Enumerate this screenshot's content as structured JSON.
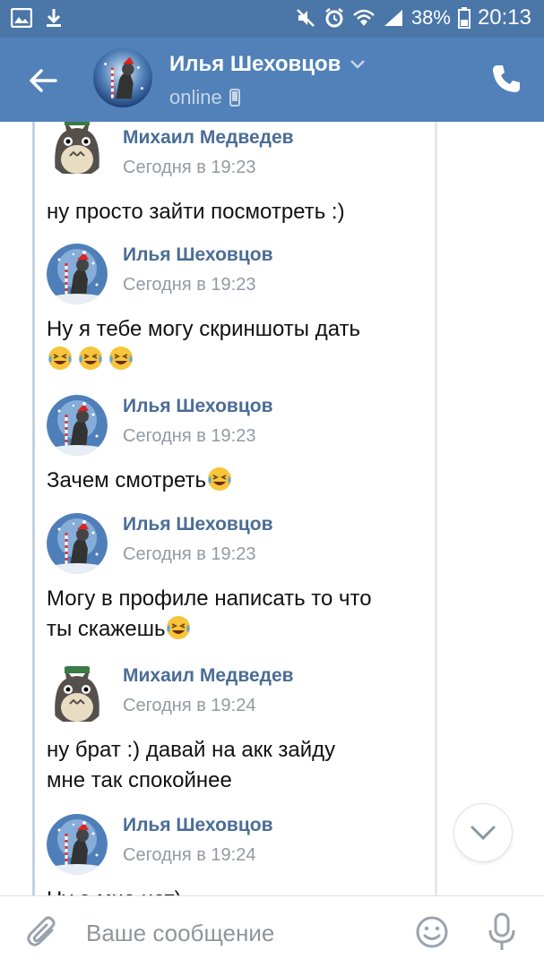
{
  "status_bar": {
    "battery": "38%",
    "time": "20:13"
  },
  "header": {
    "contact_name": "Илья Шеховцов",
    "status": "online"
  },
  "messages": [
    {
      "author": "Михаил Медведев",
      "time": "Сегодня в 19:23",
      "text": "ну просто зайти посмотреть :)",
      "line2": "",
      "emoji_count": 0,
      "avatar": "totoro"
    },
    {
      "author": "Илья Шеховцов",
      "time": "Сегодня в 19:23",
      "text": "Ну я тебе могу скриншоты дать",
      "line2": "",
      "emoji_count": 3,
      "avatar": "raccoon"
    },
    {
      "author": "Илья Шеховцов",
      "time": "Сегодня в 19:23",
      "text": "Зачем смотреть",
      "line2": "",
      "emoji_count": 1,
      "avatar": "raccoon"
    },
    {
      "author": "Илья Шеховцов",
      "time": "Сегодня в 19:23",
      "text": "Могу в профиле написать то что",
      "line2": "ты скажешь",
      "emoji_count": 1,
      "avatar": "raccoon"
    },
    {
      "author": "Михаил Медведев",
      "time": "Сегодня в 19:24",
      "text": "ну брат :) давай на акк зайду",
      "line2": "мне так спокойнее",
      "emoji_count": 0,
      "avatar": "totoro"
    },
    {
      "author": "Илья Шеховцов",
      "time": "Сегодня в 19:24",
      "text": "Ну а мне нет)",
      "line2": "",
      "emoji_count": 0,
      "avatar": "raccoon"
    }
  ],
  "composer": {
    "placeholder": "Ваше сообщение"
  },
  "colors": {
    "header": "#5181b8",
    "status_bar": "#4a76a8",
    "author": "#4a6d96",
    "timestamp": "#939aa3"
  },
  "icons": [
    "image-icon",
    "download-icon",
    "mute-icon",
    "alarm-icon",
    "wifi-icon",
    "signal-icon",
    "battery-icon",
    "back-arrow-icon",
    "chevron-down-icon",
    "phone-icon",
    "mobile-icon",
    "attach-icon",
    "emoji-icon",
    "mic-icon",
    "scroll-down-icon"
  ]
}
